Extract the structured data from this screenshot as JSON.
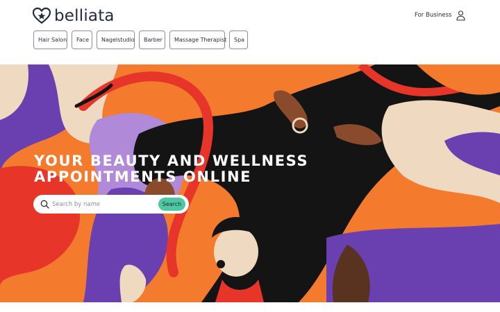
{
  "brand": {
    "name": "belliata"
  },
  "header": {
    "for_business": "For Business",
    "user_icon": "user-icon"
  },
  "categories": [
    {
      "label": "Hair Salon"
    },
    {
      "label": "Face"
    },
    {
      "label": "Nagelstudio"
    },
    {
      "label": "Barber"
    },
    {
      "label": "Massage Therapist"
    },
    {
      "label": "Spa"
    }
  ],
  "hero": {
    "headline_line1": "YOUR BEAUTY AND WELLNESS",
    "headline_line2": "APPOINTMENTS ONLINE"
  },
  "search": {
    "placeholder": "Search by name",
    "value": "",
    "button_label": "Search",
    "icon": "search-icon"
  },
  "colors": {
    "accent": "#4fc7a3",
    "brand_text": "#232a44",
    "hero_orange": "#f47a2e",
    "hero_purple": "#6a3fb0",
    "hero_red": "#e8352a",
    "hero_black": "#141414",
    "hero_cream": "#efd9c0"
  }
}
